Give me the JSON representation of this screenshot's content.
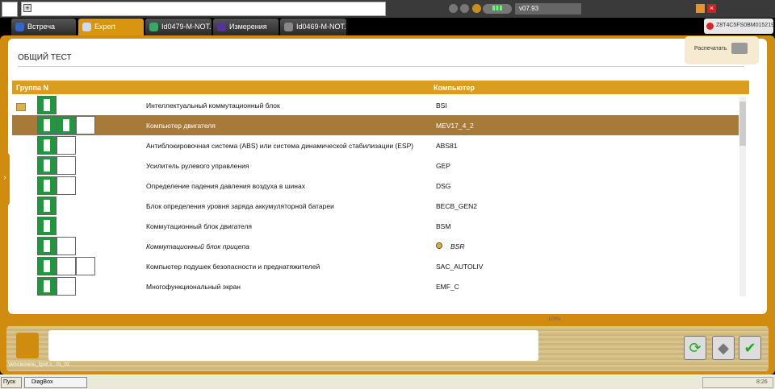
{
  "top": {
    "version": "v07.93",
    "add": "+"
  },
  "tabs": [
    {
      "label": "Встреча"
    },
    {
      "label": "Expert"
    },
    {
      "label": "Id0479-M-NOT..."
    },
    {
      "label": "Измерения"
    },
    {
      "label": "Id0469-M-NOT..."
    }
  ],
  "vin": "Z8T4C5FS0BM015219",
  "page": {
    "title": "ОБЩИЙ ТЕСТ",
    "print_label": "Распечатать"
  },
  "table": {
    "headers": [
      "Группа N",
      "Компьютер"
    ],
    "rows": [
      {
        "name": "Интеллектуальный коммутационный блок",
        "computer": "BSI"
      },
      {
        "name": "Компьютер двигателя",
        "computer": "MEV17_4_2"
      },
      {
        "name": "Антиблокировочная система (ABS) или система динамической стабилизации (ESP)",
        "computer": "ABS81"
      },
      {
        "name": "Усилитель рулевого управления",
        "computer": "GEP"
      },
      {
        "name": "Определение падения давления воздуха в шинах",
        "computer": "DSG"
      },
      {
        "name": "Блок определения уровня заряда аккумуляторной батареи",
        "computer": "BECB_GEN2"
      },
      {
        "name": "Коммутационный блок двигателя",
        "computer": "BSM"
      },
      {
        "name": "Коммутационный блок прицепа",
        "computer": "BSR"
      },
      {
        "name": "Компьютер подушек безопасности и преднатяжителей",
        "computer": "SAC_AUTOLIV"
      },
      {
        "name": "Многофункциональный экран",
        "computer": "EMF_C"
      }
    ]
  },
  "progress": {
    "value": 100,
    "label": "100%"
  },
  "status": "Vehiclemenu_fgref.s : 01_02",
  "taskbar": {
    "start": "Пуск",
    "task": "DiagBox",
    "clock": "8:26"
  },
  "colors": {
    "accent": "#d08c0e",
    "selected": "#a87a3a"
  }
}
